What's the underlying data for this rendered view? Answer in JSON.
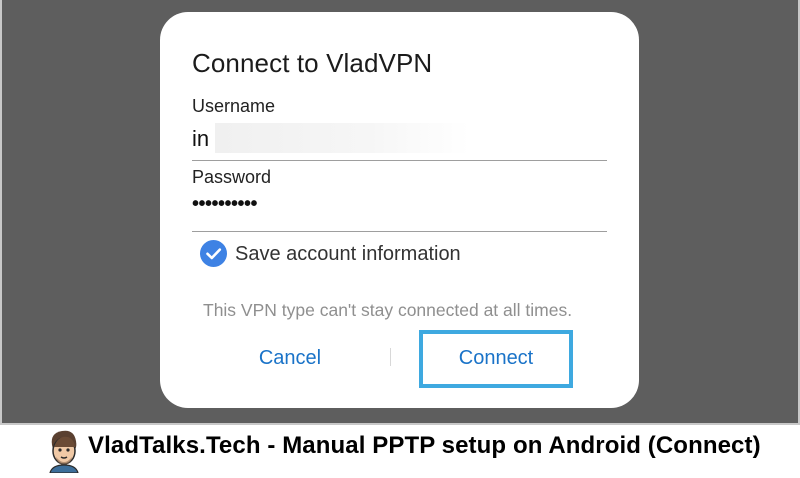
{
  "dialog": {
    "title": "Connect to VladVPN",
    "username_label": "Username",
    "username_value": "in",
    "password_label": "Password",
    "password_value": "••••••••••",
    "save_label": "Save account information",
    "save_checked": true,
    "info_text": "This VPN type can't stay connected at all times.",
    "cancel_label": "Cancel",
    "connect_label": "Connect"
  },
  "footer": {
    "caption": "VladTalks.Tech - Manual PPTP setup on Android (Connect)"
  },
  "colors": {
    "accent": "#1a73c8",
    "checkbox": "#3e82e4",
    "highlight": "#3ea9e0",
    "backdrop": "#5e5e5e"
  },
  "icons": {
    "checkbox": "check-circle-icon",
    "avatar": "avatar-icon"
  }
}
